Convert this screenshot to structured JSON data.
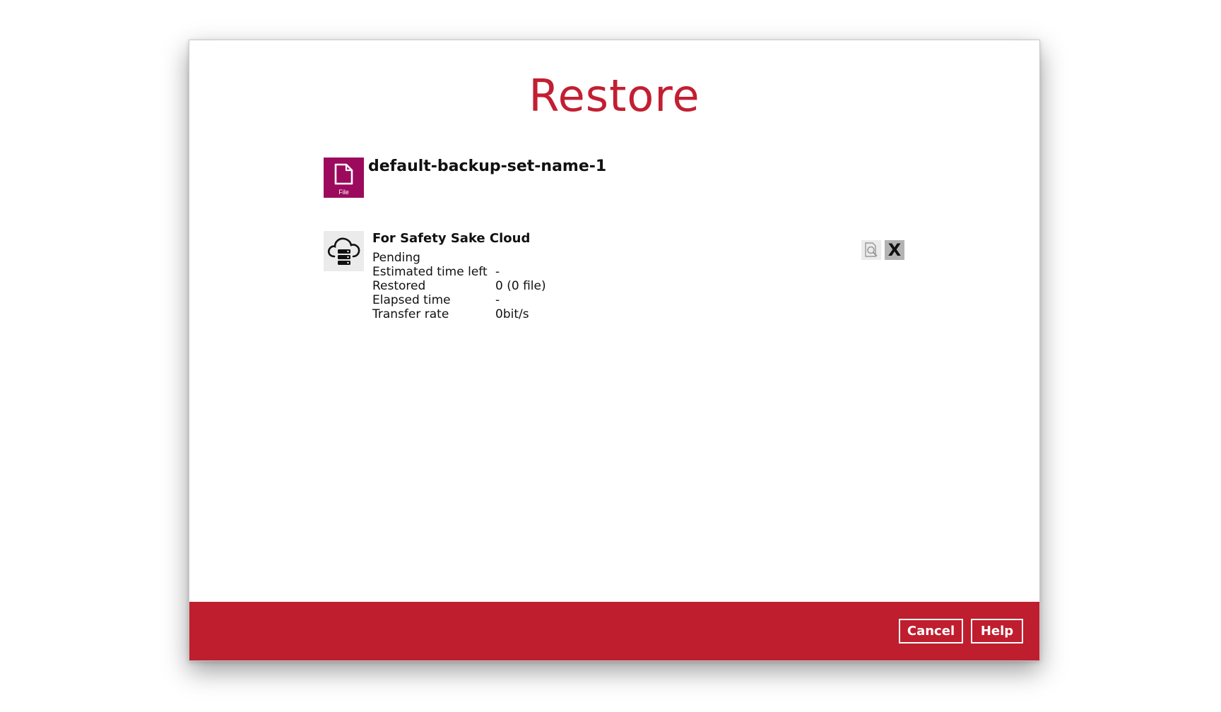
{
  "dialog": {
    "title": "Restore"
  },
  "backup_set": {
    "icon": "file-icon",
    "icon_label": "File",
    "name": "default-backup-set-name-1"
  },
  "destination": {
    "icon": "cloud-server-icon",
    "name": "For Safety Sake Cloud",
    "status": "Pending",
    "details": [
      {
        "label": "Estimated time left",
        "value": "-"
      },
      {
        "label": "Restored",
        "value": "0 (0 file)"
      },
      {
        "label": "Elapsed time",
        "value": "-"
      },
      {
        "label": "Transfer rate",
        "value": "0bit/s"
      }
    ],
    "actions": {
      "view_log_icon": "magnifier-document-icon",
      "stop_label": "X"
    }
  },
  "footer": {
    "cancel_label": "Cancel",
    "help_label": "Help"
  },
  "colors": {
    "accent": "#c21f32",
    "footer_bg": "#bf1e2e",
    "file_icon_bg": "#9c0a5e"
  }
}
